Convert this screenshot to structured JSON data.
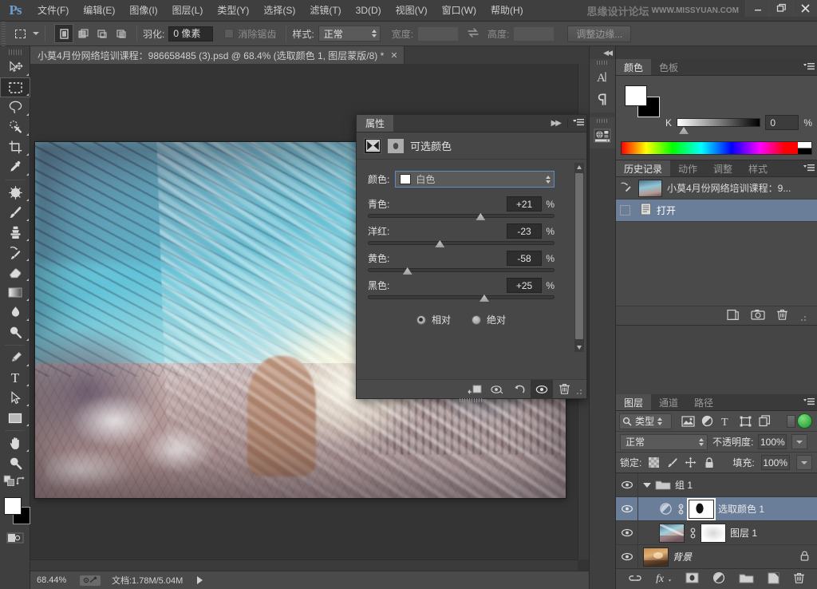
{
  "app": {
    "logo": "Ps",
    "watermark_cn": "思缘设计论坛",
    "watermark_en": "WWW.MISSYUAN.COM"
  },
  "menubar": {
    "items": [
      {
        "label": "文件(F)"
      },
      {
        "label": "编辑(E)"
      },
      {
        "label": "图像(I)"
      },
      {
        "label": "图层(L)"
      },
      {
        "label": "类型(Y)"
      },
      {
        "label": "选择(S)"
      },
      {
        "label": "滤镜(T)"
      },
      {
        "label": "3D(D)"
      },
      {
        "label": "视图(V)"
      },
      {
        "label": "窗口(W)"
      },
      {
        "label": "帮助(H)"
      }
    ]
  },
  "window_controls": {
    "minimize": "—",
    "restore": "❐",
    "close": "✕"
  },
  "options_bar": {
    "tool_icon": "rectangular-marquee-icon",
    "selection_modes": [
      "new-selection",
      "add-to-selection",
      "subtract-from-selection",
      "intersect-selection"
    ],
    "feather_label": "羽化:",
    "feather_value": "0 像素",
    "antialias_label": "消除锯齿",
    "antialias_checked": false,
    "style_label": "样式:",
    "style_value": "正常",
    "width_label": "宽度:",
    "width_value": "",
    "swap_icon": "swap-icon",
    "height_label": "高度:",
    "height_value": "",
    "refine_edge_label": "调整边缘..."
  },
  "toolbox": {
    "tools": [
      {
        "name": "move-tool",
        "active": false
      },
      {
        "name": "rectangular-marquee-tool",
        "active": true
      },
      {
        "name": "lasso-tool",
        "active": false
      },
      {
        "name": "quick-selection-tool",
        "active": false
      },
      {
        "name": "crop-tool",
        "active": false
      },
      {
        "name": "eyedropper-tool",
        "active": false
      },
      {
        "name": "spot-healing-brush-tool",
        "active": false
      },
      {
        "name": "brush-tool",
        "active": false
      },
      {
        "name": "clone-stamp-tool",
        "active": false
      },
      {
        "name": "history-brush-tool",
        "active": false
      },
      {
        "name": "eraser-tool",
        "active": false
      },
      {
        "name": "gradient-tool",
        "active": false
      },
      {
        "name": "blur-tool",
        "active": false
      },
      {
        "name": "dodge-tool",
        "active": false
      },
      {
        "name": "pen-tool",
        "active": false
      },
      {
        "name": "type-tool",
        "active": false
      },
      {
        "name": "path-selection-tool",
        "active": false
      },
      {
        "name": "rectangle-tool",
        "active": false
      },
      {
        "name": "hand-tool",
        "active": false
      },
      {
        "name": "zoom-tool",
        "active": false
      }
    ],
    "foreground_color": "#ffffff",
    "background_color": "#000000",
    "type_tool_glyph": "T"
  },
  "document": {
    "tab_title": "小莫4月份网络培训课程：986658485 (3).psd @ 68.4% (选取颜色 1, 图层蒙版/8) *",
    "close_glyph": "✕"
  },
  "status_bar": {
    "zoom": "68.44%",
    "doc_info": "文档:1.78M/5.04M"
  },
  "properties_panel": {
    "tab_label": "属性",
    "title": "可选颜色",
    "adjustment_icon": "selective-color-icon",
    "mask_icon": "layer-mask-icon",
    "color_label": "颜色:",
    "color_value": "白色",
    "sliders": [
      {
        "label": "青色:",
        "value": "+21",
        "unit": "%",
        "pct": 60.5
      },
      {
        "label": "洋红:",
        "value": "-23",
        "unit": "%",
        "pct": 38.5
      },
      {
        "label": "黄色:",
        "value": "-58",
        "unit": "%",
        "pct": 21.0
      },
      {
        "label": "黑色:",
        "value": "+25",
        "unit": "%",
        "pct": 62.5
      }
    ],
    "method_relative": "相对",
    "method_absolute": "绝对",
    "method_selected": "相对",
    "footer_buttons": [
      {
        "name": "clip-to-layer-button"
      },
      {
        "name": "toggle-preview-button"
      },
      {
        "name": "reset-button"
      },
      {
        "name": "visibility-button"
      },
      {
        "name": "delete-button"
      }
    ]
  },
  "icon_dock": {
    "collapse_glyph": "◀◀",
    "groups": [
      {
        "icons": [
          {
            "name": "character-panel-icon",
            "glyph": "A"
          },
          {
            "name": "paragraph-panel-icon",
            "glyph": "¶"
          }
        ]
      },
      {
        "icons": [
          {
            "name": "3d-panel-icon",
            "glyph": "◈"
          }
        ]
      }
    ]
  },
  "color_panel": {
    "tabs": [
      {
        "label": "颜色",
        "active": true
      },
      {
        "label": "色板",
        "active": false
      }
    ],
    "channel_label": "K",
    "channel_value": "0",
    "unit": "%",
    "foreground": "#ffffff",
    "background": "#000000"
  },
  "history_panel": {
    "tabs": [
      {
        "label": "历史记录",
        "active": true
      },
      {
        "label": "动作",
        "active": false
      },
      {
        "label": "调整",
        "active": false
      },
      {
        "label": "样式",
        "active": false
      }
    ],
    "items": [
      {
        "label": "小莫4月份网络培训课程：9...",
        "selected": false,
        "kind": "snapshot"
      },
      {
        "label": "打开",
        "selected": true,
        "kind": "state"
      }
    ],
    "footer_buttons": [
      {
        "name": "new-document-from-state-button"
      },
      {
        "name": "new-snapshot-button"
      },
      {
        "name": "delete-state-button"
      }
    ]
  },
  "layers_panel": {
    "tabs": [
      {
        "label": "图层",
        "active": true
      },
      {
        "label": "通道",
        "active": false
      },
      {
        "label": "路径",
        "active": false
      }
    ],
    "filter_label": "类型",
    "filter_icons": [
      "pixel-filter-icon",
      "adjustment-filter-icon",
      "type-filter-icon",
      "shape-filter-icon",
      "smart-object-filter-icon"
    ],
    "blend_mode": "正常",
    "opacity_label": "不透明度:",
    "opacity_value": "100%",
    "lock_label": "锁定:",
    "lock_icons": [
      "lock-transparent-pixels-icon",
      "lock-image-pixels-icon",
      "lock-position-icon",
      "lock-all-icon"
    ],
    "fill_label": "填充:",
    "fill_value": "100%",
    "layers": [
      {
        "name": "组 1",
        "type": "group",
        "visible": true,
        "selected": false,
        "expanded": true,
        "indent": 0
      },
      {
        "name": "选取颜色 1",
        "type": "adjustment",
        "visible": true,
        "selected": true,
        "linked": true,
        "indent": 1
      },
      {
        "name": "图层 1",
        "type": "pixel",
        "visible": true,
        "selected": false,
        "linked": true,
        "indent": 1
      },
      {
        "name": "背景",
        "type": "background",
        "visible": true,
        "selected": false,
        "locked": true,
        "indent": 0
      }
    ],
    "footer_buttons": [
      {
        "name": "link-layers-button",
        "glyph": "⛓"
      },
      {
        "name": "layer-style-button",
        "glyph": "fx"
      },
      {
        "name": "add-layer-mask-button"
      },
      {
        "name": "new-adjustment-layer-button"
      },
      {
        "name": "new-group-button"
      },
      {
        "name": "new-layer-button"
      },
      {
        "name": "delete-layer-button"
      }
    ]
  },
  "colors": {
    "accent_selected": "#6a7d99",
    "panel_bg": "#454545",
    "app_bg": "#3c3c3c",
    "toolbar_bg": "#4a4a4a",
    "green_indicator": "#2f9f3f"
  }
}
